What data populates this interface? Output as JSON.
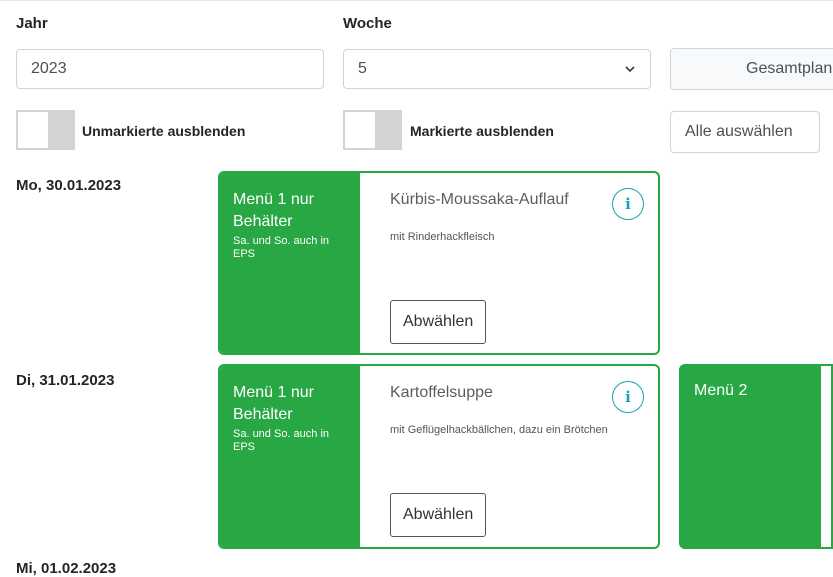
{
  "filters": {
    "year_label": "Jahr",
    "year_value": "2023",
    "week_label": "Woche",
    "week_value": "5",
    "overview_button": "Gesamtplan"
  },
  "toggles": {
    "hide_unmarked_label": "Unmarkierte ausblenden",
    "hide_marked_label": "Markierte ausblenden",
    "select_all_button": "Alle auswählen"
  },
  "days": [
    {
      "date": "Mo, 30.01.2023",
      "meals": [
        {
          "menu_name": "Menü 1 nur Behälter",
          "menu_note": "Sa. und So. auch in EPS",
          "dish": "Kürbis-Moussaka-Auflauf",
          "description": "mit Rinderhackfleisch",
          "action": "Abwählen",
          "info_glyph": "i"
        }
      ]
    },
    {
      "date": "Di, 31.01.2023",
      "meals": [
        {
          "menu_name": "Menü 1 nur Behälter",
          "menu_note": "Sa. und So. auch in EPS",
          "dish": "Kartoffelsuppe",
          "description": "mit Geflügelhackbällchen, dazu ein Brötchen",
          "action": "Abwählen",
          "info_glyph": "i"
        },
        {
          "menu_name": "Menü 2"
        }
      ]
    },
    {
      "date": "Mi, 01.02.2023"
    }
  ],
  "colors": {
    "accent_green": "#28a745",
    "info_teal": "#17a2b8"
  }
}
